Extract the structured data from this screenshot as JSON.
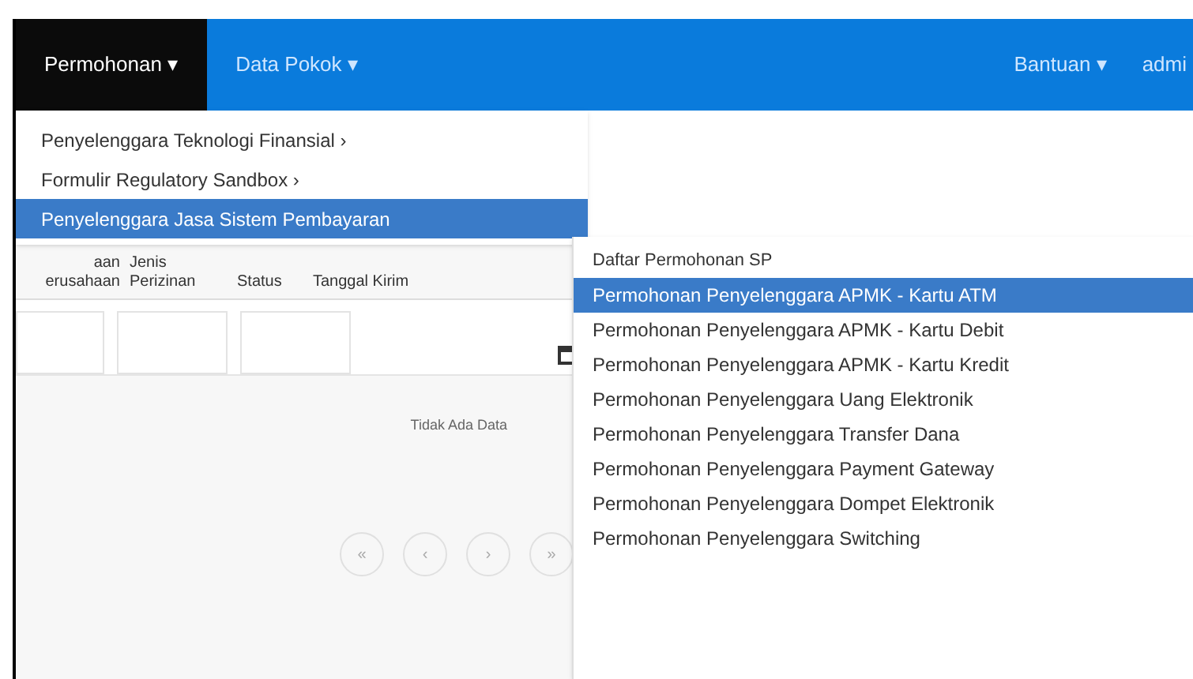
{
  "navbar": {
    "items": [
      {
        "label": "Permohonan",
        "caret": "▾",
        "selected": true
      },
      {
        "label": "Data Pokok",
        "caret": "▾",
        "selected": false
      }
    ],
    "right_items": [
      {
        "label": "Bantuan",
        "caret": "▾"
      },
      {
        "label": "admi"
      }
    ]
  },
  "dropdown": {
    "items": [
      {
        "label": "Penyelenggara Teknologi Finansial",
        "arrow": "›",
        "selected": false
      },
      {
        "label": "Formulir Regulatory Sandbox",
        "arrow": "›",
        "selected": false
      },
      {
        "label": "Penyelenggara Jasa Sistem Pembayaran",
        "selected": true
      }
    ]
  },
  "submenu": {
    "header": "Daftar Permohonan SP",
    "items": [
      {
        "label": "Permohonan Penyelenggara APMK - Kartu ATM",
        "selected": true
      },
      {
        "label": "Permohonan Penyelenggara APMK - Kartu Debit",
        "selected": false
      },
      {
        "label": "Permohonan Penyelenggara APMK - Kartu Kredit",
        "selected": false
      },
      {
        "label": "Permohonan Penyelenggara Uang Elektronik",
        "selected": false
      },
      {
        "label": "Permohonan Penyelenggara Transfer Dana",
        "selected": false
      },
      {
        "label": "Permohonan Penyelenggara Payment Gateway",
        "selected": false
      },
      {
        "label": "Permohonan Penyelenggara Dompet Elektronik",
        "selected": false
      },
      {
        "label": "Permohonan Penyelenggara Switching",
        "selected": false
      }
    ]
  },
  "table": {
    "columns": [
      {
        "lines": [
          "aan",
          "erusahaan"
        ]
      },
      {
        "lines": [
          "Jenis",
          "Perizinan"
        ]
      },
      {
        "lines": [
          "Status"
        ]
      },
      {
        "lines": [
          "Tanggal Kirim"
        ]
      }
    ],
    "empty_message": "Tidak Ada Data"
  },
  "pagination": [
    "«",
    "‹",
    "›",
    "»"
  ]
}
